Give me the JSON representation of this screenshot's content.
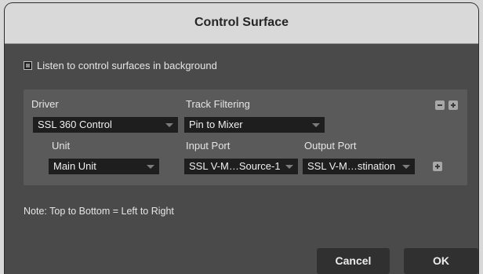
{
  "dialog": {
    "title": "Control Surface",
    "listen_label": "Listen to control surfaces in background",
    "listen_checked": true,
    "driver_label": "Driver",
    "driver_value": "SSL 360 Control",
    "track_filtering_label": "Track Filtering",
    "track_filtering_value": "Pin to Mixer",
    "unit_label": "Unit",
    "unit_value": "Main Unit",
    "input_port_label": "Input Port",
    "input_port_value": "SSL V-M…Source-1",
    "output_port_label": "Output Port",
    "output_port_value": "SSL V-M…stination",
    "note": "Note: Top to Bottom = Left to Right",
    "cancel_label": "Cancel",
    "ok_label": "OK"
  },
  "colors": {
    "background": "#4a4a4a",
    "panel": "#5a5a5a",
    "titlebar": "#d9d9d9",
    "dropdown": "#1e1e1e",
    "button": "#303030"
  },
  "icons": {
    "remove_surface": "minus-icon",
    "add_surface": "plus-icon",
    "add_port": "plus-icon",
    "dropdown": "chevron-down-icon"
  }
}
